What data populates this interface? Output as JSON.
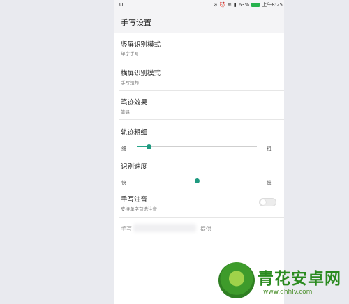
{
  "status_bar": {
    "usb_icon": "ψ",
    "battery_percent": "63%",
    "time": "上午8:25",
    "icons": [
      "mute-icon",
      "alarm-icon",
      "wifi-icon",
      "signal-icon",
      "battery-icon"
    ]
  },
  "header": {
    "title": "手写设置"
  },
  "settings": {
    "portrait_mode": {
      "label": "竖屏识别模式",
      "value": "单字手写"
    },
    "landscape_mode": {
      "label": "横屏识别模式",
      "value": "手写短句"
    },
    "stroke_effect": {
      "label": "笔迹效果",
      "value": "笔锋"
    },
    "stroke_width": {
      "label": "轨迹粗细",
      "min_label": "细",
      "max_label": "粗",
      "level": 0.1
    },
    "recognition_speed": {
      "label": "识别速度",
      "min_label": "快",
      "max_label": "慢",
      "level": 0.5
    },
    "pinyin": {
      "label": "手写注音",
      "desc": "支持单字首选注音",
      "enabled": false
    },
    "provider": {
      "prefix": "手写",
      "suffix": "提供"
    }
  },
  "watermark": {
    "title": "青花安卓网",
    "url": "www.qhhlv.com"
  },
  "colors": {
    "accent": "#2aa58a",
    "background": "#e9eaef",
    "panel": "#ffffff",
    "header": "#f4f4f6"
  }
}
